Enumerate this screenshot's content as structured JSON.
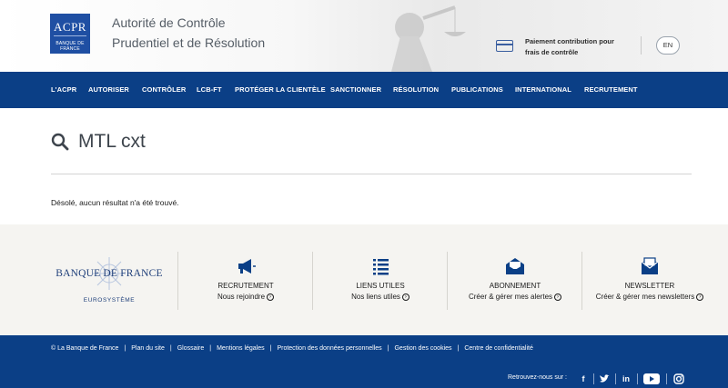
{
  "header": {
    "logo_top": "ACPR",
    "logo_bottom": "BANQUE DE FRANCE",
    "title_line1": "Autorité de Contrôle",
    "title_line2": "Prudentiel et de Résolution",
    "payment_line1": "Paiement contribution pour",
    "payment_line2": "frais de contrôle",
    "lang": "EN"
  },
  "nav": {
    "items": [
      "L'ACPR",
      "AUTORISER",
      "CONTRÔLER",
      "LCB-FT",
      "PROTÉGER LA CLIENTÈLE",
      "SANCTIONNER",
      "RÉSOLUTION",
      "PUBLICATIONS",
      "INTERNATIONAL",
      "RECRUTEMENT"
    ]
  },
  "search": {
    "query": "MTL cxt",
    "no_result": "Désolé, aucun résultat n'a été trouvé."
  },
  "footer": {
    "bdf_name": "BANQUE DE FRANCE",
    "bdf_sub": "EUROSYSTÈME",
    "columns": [
      {
        "title": "RECRUTEMENT",
        "link": "Nous rejoindre",
        "icon": "megaphone-icon"
      },
      {
        "title": "LIENS UTILES",
        "link": "Nos liens utiles",
        "icon": "checklist-icon"
      },
      {
        "title": "ABONNEMENT",
        "link": "Créer & gérer mes alertes",
        "icon": "envelope-open-icon"
      },
      {
        "title": "NEWSLETTER",
        "link": "Créer & gérer mes newsletters",
        "icon": "newsletter-icon"
      }
    ],
    "bottom_links": [
      "© La Banque de France",
      "Plan du site",
      "Glossaire",
      "Mentions légales",
      "Protection des données personnelles",
      "Gestion des cookies",
      "Centre de confidentialité"
    ],
    "follow_label": "Retrouvez-nous sur :",
    "social": [
      "f",
      "twitter",
      "in",
      "youtube",
      "instagram"
    ]
  },
  "colors": {
    "nav_bg": "#0b3f86",
    "footer_bg": "#f5f4f1",
    "logo_blue": "#1f4fa3"
  }
}
